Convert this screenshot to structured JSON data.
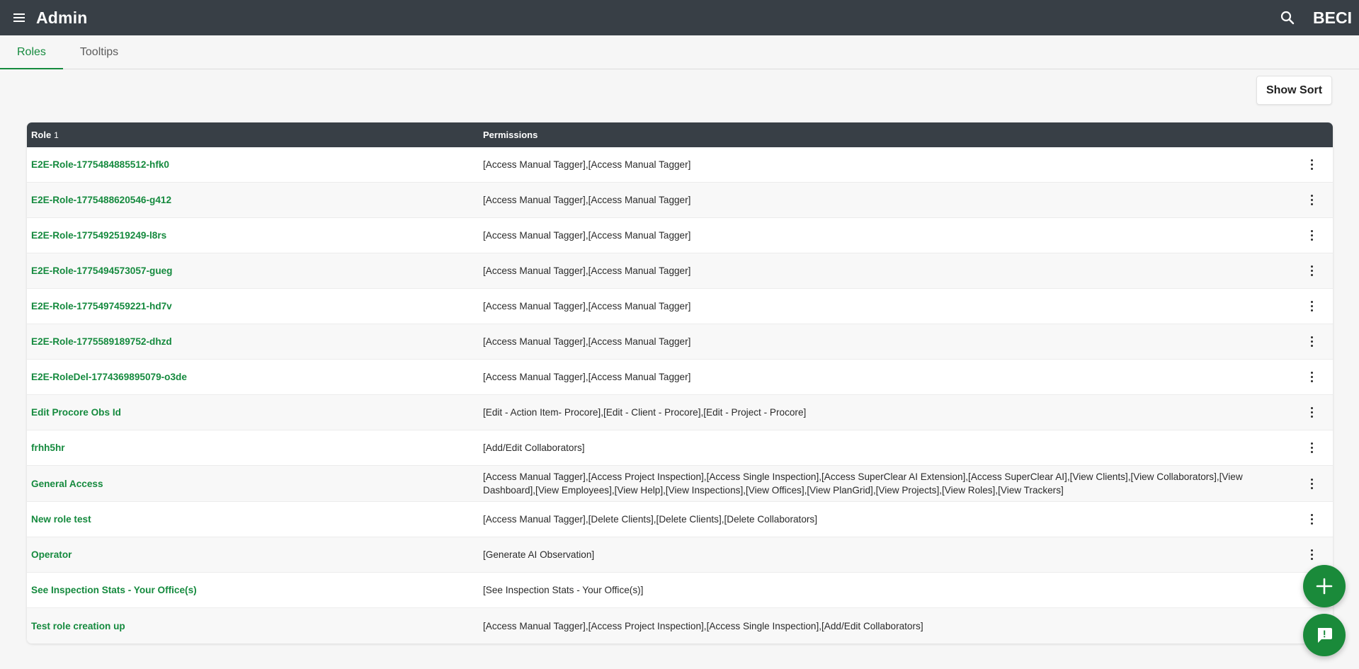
{
  "appbar": {
    "title": "Admin",
    "brand": "BECI",
    "menu_icon": "hamburger-menu-icon",
    "search_icon": "search-icon"
  },
  "tabs": [
    {
      "label": "Roles",
      "active": true
    },
    {
      "label": "Tooltips",
      "active": false
    }
  ],
  "toolbar": {
    "show_sort_label": "Show Sort"
  },
  "table": {
    "headers": {
      "role": "Role",
      "role_sort_index": "1",
      "permissions": "Permissions"
    },
    "rows": [
      {
        "role": "E2E-Role-1775484885512-hfk0",
        "permissions": "[Access Manual Tagger],[Access Manual Tagger]"
      },
      {
        "role": "E2E-Role-1775488620546-g412",
        "permissions": "[Access Manual Tagger],[Access Manual Tagger]"
      },
      {
        "role": "E2E-Role-1775492519249-l8rs",
        "permissions": "[Access Manual Tagger],[Access Manual Tagger]"
      },
      {
        "role": "E2E-Role-1775494573057-gueg",
        "permissions": "[Access Manual Tagger],[Access Manual Tagger]"
      },
      {
        "role": "E2E-Role-1775497459221-hd7v",
        "permissions": "[Access Manual Tagger],[Access Manual Tagger]"
      },
      {
        "role": "E2E-Role-1775589189752-dhzd",
        "permissions": "[Access Manual Tagger],[Access Manual Tagger]"
      },
      {
        "role": "E2E-RoleDel-1774369895079-o3de",
        "permissions": "[Access Manual Tagger],[Access Manual Tagger]"
      },
      {
        "role": "Edit Procore Obs Id",
        "permissions": "[Edit - Action Item- Procore],[Edit - Client - Procore],[Edit - Project - Procore]"
      },
      {
        "role": "frhh5hr",
        "permissions": "[Add/Edit Collaborators]"
      },
      {
        "role": "General Access",
        "permissions": "[Access Manual Tagger],[Access Project Inspection],[Access Single Inspection],[Access SuperClear AI Extension],[Access SuperClear AI],[View Clients],[View Collaborators],[View Dashboard],[View Employees],[View Help],[View Inspections],[View Offices],[View PlanGrid],[View Projects],[View Roles],[View Trackers]"
      },
      {
        "role": "New role test",
        "permissions": "[Access Manual Tagger],[Delete Clients],[Delete Clients],[Delete Collaborators]"
      },
      {
        "role": "Operator",
        "permissions": "[Generate AI Observation]"
      },
      {
        "role": "See Inspection Stats - Your Office(s)",
        "permissions": "[See Inspection Stats - Your Office(s)]"
      },
      {
        "role": "Test role creation up",
        "permissions": "[Access Manual Tagger],[Access Project Inspection],[Access Single Inspection],[Add/Edit Collaborators]"
      }
    ],
    "row_action_icon": "more-vertical-icon"
  },
  "fabs": {
    "add_icon": "plus-icon",
    "feedback_icon": "feedback-chat-icon"
  },
  "colors": {
    "appbar": "#383f46",
    "accent_green": "#158a3e",
    "fab_green": "#1a8a3a"
  }
}
